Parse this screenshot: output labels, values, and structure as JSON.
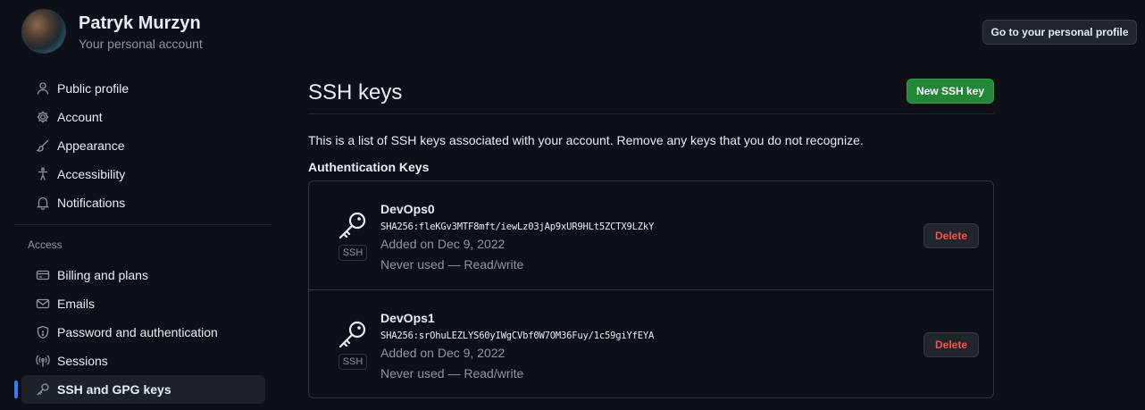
{
  "user": {
    "name": "Patryk Murzyn",
    "subtitle": "Your personal account",
    "profile_button": "Go to your personal profile"
  },
  "sidebar": {
    "items": [
      {
        "label": "Public profile",
        "icon": "person-icon"
      },
      {
        "label": "Account",
        "icon": "gear-icon"
      },
      {
        "label": "Appearance",
        "icon": "paintbrush-icon"
      },
      {
        "label": "Accessibility",
        "icon": "accessibility-icon"
      },
      {
        "label": "Notifications",
        "icon": "bell-icon"
      }
    ],
    "access_heading": "Access",
    "access_items": [
      {
        "label": "Billing and plans",
        "icon": "credit-card-icon"
      },
      {
        "label": "Emails",
        "icon": "mail-icon"
      },
      {
        "label": "Password and authentication",
        "icon": "shield-lock-icon"
      },
      {
        "label": "Sessions",
        "icon": "broadcast-icon"
      },
      {
        "label": "SSH and GPG keys",
        "icon": "key-icon",
        "active": true
      }
    ]
  },
  "main": {
    "title": "SSH keys",
    "new_key_button": "New SSH key",
    "intro": "This is a list of SSH keys associated with your account. Remove any keys that you do not recognize.",
    "section_title": "Authentication Keys",
    "keys": [
      {
        "name": "DevOps0",
        "fingerprint": "SHA256:fleKGv3MTF8mft/iewLz03jAp9xUR9HLt5ZCTX9LZkY",
        "added": "Added on Dec 9, 2022",
        "usage": "Never used — Read/write",
        "badge": "SSH",
        "delete_label": "Delete"
      },
      {
        "name": "DevOps1",
        "fingerprint": "SHA256:srOhuLEZLYS60yIWgCVbf0W7OM36Fuy/1c59giYfEYA",
        "added": "Added on Dec 9, 2022",
        "usage": "Never used — Read/write",
        "badge": "SSH",
        "delete_label": "Delete"
      }
    ]
  },
  "colors": {
    "background": "#0d1117",
    "accent_green": "#238636",
    "danger": "#f85149",
    "active_indicator": "#2f81f7"
  }
}
